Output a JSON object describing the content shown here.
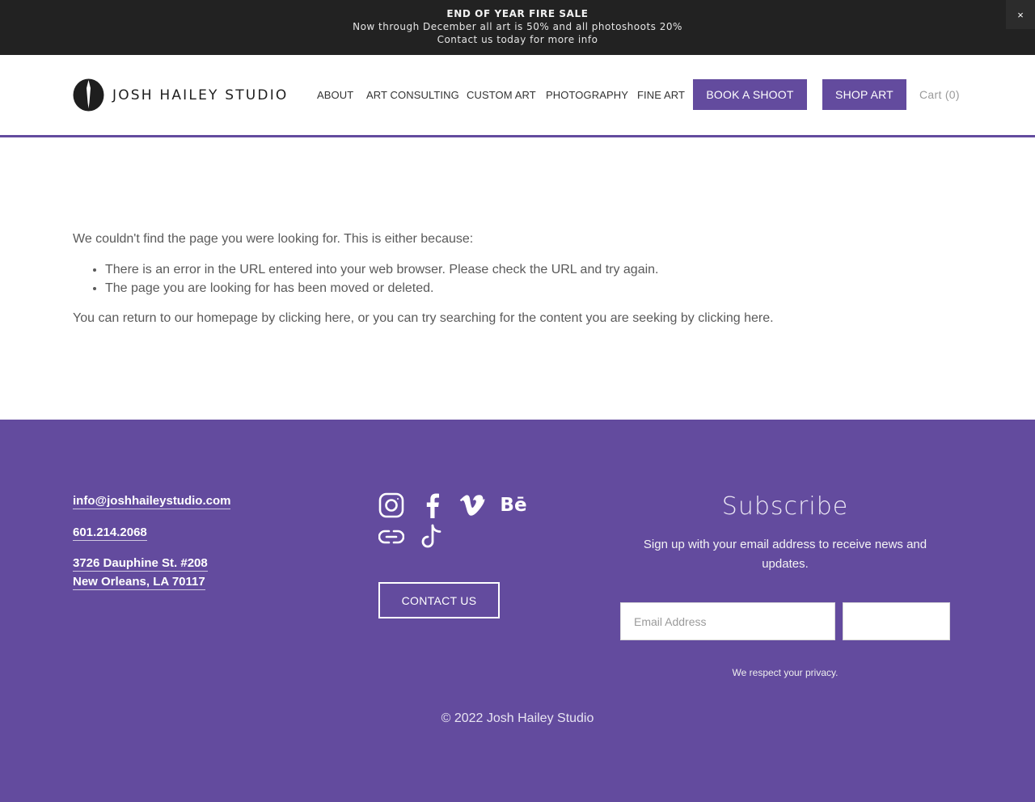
{
  "announcement": {
    "title": "END OF YEAR FIRE SALE",
    "line1": "Now through December all art is 50% and all photoshoots 20%",
    "line2": "Contact us today for more info",
    "close_label": "×"
  },
  "header": {
    "logo_text": "JOSH HAILEY STUDIO",
    "nav": {
      "about": "ABOUT",
      "art_consulting": "ART CONSULTING",
      "custom_art": "CUSTOM ART",
      "photography": "PHOTOGRAPHY",
      "fine_art": "FINE ART"
    },
    "book_label": "BOOK A SHOOT",
    "shop_label": "SHOP ART",
    "cart_label": "Cart (0)"
  },
  "main": {
    "intro": "We couldn't find the page you were looking for. This is either because:",
    "reasons": [
      "There is an error in the URL entered into your web browser. Please check the URL and try again.",
      "The page you are looking for has been moved or deleted."
    ],
    "outro_prefix": "You can return to our homepage by ",
    "link1": "clicking here",
    "outro_middle": ", or you can try searching for the content you are seeking by ",
    "link2": "clicking here",
    "outro_suffix": "."
  },
  "footer": {
    "email": "info@joshhaileystudio.com",
    "phone": "601.214.2068",
    "address_line1": "3726 Dauphine St. #208",
    "address_line2": "New Orleans, LA 70117",
    "social_icons": [
      "instagram-icon",
      "facebook-icon",
      "vimeo-icon",
      "behance-icon",
      "link-icon",
      "tiktok-icon"
    ],
    "behance_glyph": "Bē",
    "contact_label": "CONTACT US",
    "subscribe_title": "Subscribe",
    "subscribe_desc": "Sign up with your email address to receive news and updates.",
    "email_placeholder": "Email Address",
    "signup_label": "",
    "privacy": "We respect your privacy.",
    "copyright": "© 2022 Josh Hailey Studio"
  },
  "colors": {
    "brand_purple": "#634b9e",
    "announcement_bg": "#222222",
    "text": "#5a5a5a"
  }
}
